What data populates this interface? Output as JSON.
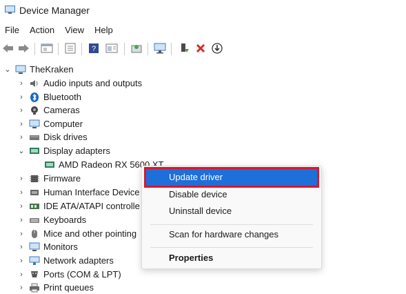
{
  "window": {
    "title": "Device Manager"
  },
  "menu": [
    "File",
    "Action",
    "View",
    "Help"
  ],
  "toolbar": {
    "buttons": [
      "back-icon",
      "forward-icon",
      "properties-icon",
      "list-icon",
      "help-icon",
      "view-icon",
      "scan-icon",
      "monitor-icon",
      "update-driver-icon",
      "uninstall-icon",
      "download-icon"
    ]
  },
  "tree": {
    "root": "TheKraken",
    "items": [
      "Audio inputs and outputs",
      "Bluetooth",
      "Cameras",
      "Computer",
      "Disk drives",
      "Display adapters",
      "AMD Radeon RX 5600 XT",
      "Firmware",
      "Human Interface Device",
      "IDE ATA/ATAPI controlle",
      "Keyboards",
      "Mice and other pointing",
      "Monitors",
      "Network adapters",
      "Ports (COM & LPT)",
      "Print queues"
    ]
  },
  "context_menu": {
    "update_driver": "Update driver",
    "disable_device": "Disable device",
    "uninstall_device": "Uninstall device",
    "scan": "Scan for hardware changes",
    "properties": "Properties",
    "highlight_color": "#1e6fd9",
    "callout_color": "#d9172a"
  }
}
